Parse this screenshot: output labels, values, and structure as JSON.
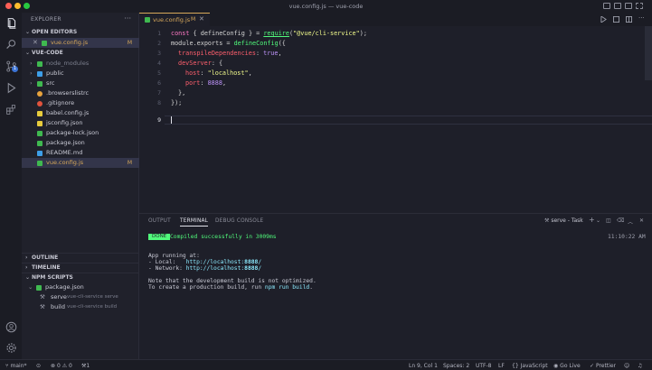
{
  "window": {
    "title": "vue.config.js — vue-code"
  },
  "colors": {
    "accent_modified": "#d7a85a",
    "badge_blue": "#3d74d6",
    "done_green": "#50fa7b"
  },
  "activity_bar": {
    "items": [
      "explorer-icon",
      "search-icon",
      "source-control-icon",
      "run-debug-icon",
      "extensions-icon"
    ],
    "source_control_badge": "1",
    "bottom": [
      "account-icon",
      "settings-gear-icon"
    ]
  },
  "sidebar": {
    "title": "EXPLORER",
    "open_editors": {
      "label": "OPEN EDITORS",
      "items": [
        {
          "name": "vue.config.js",
          "status": "M"
        }
      ]
    },
    "project": {
      "label": "VUE-CODE",
      "items": [
        {
          "name": "node_modules",
          "status": ""
        },
        {
          "name": "public",
          "status": ""
        },
        {
          "name": "src",
          "status": ""
        },
        {
          "name": ".browserslistrc",
          "status": ""
        },
        {
          "name": ".gitignore",
          "status": ""
        },
        {
          "name": "babel.config.js",
          "status": ""
        },
        {
          "name": "jsconfig.json",
          "status": ""
        },
        {
          "name": "package-lock.json",
          "status": ""
        },
        {
          "name": "package.json",
          "status": ""
        },
        {
          "name": "README.md",
          "status": ""
        },
        {
          "name": "vue.config.js",
          "status": "M"
        }
      ]
    },
    "outline": "OUTLINE",
    "timeline": "TIMELINE",
    "npm_scripts": {
      "label": "NPM SCRIPTS",
      "file": "package.json",
      "scripts": [
        {
          "name": "serve",
          "cmd": "vue-cli-service serve"
        },
        {
          "name": "build",
          "cmd": "vue-cli-service build"
        }
      ]
    }
  },
  "editor": {
    "tab": {
      "name": "vue.config.js",
      "status": "M"
    },
    "line_numbers": [
      "1",
      "2",
      "3",
      "4",
      "5",
      "6",
      "7",
      "8",
      "9"
    ],
    "code": {
      "l1": {
        "a": "const",
        "b": " { ",
        "c": "defineConfig",
        "d": " } = ",
        "e": "require",
        "f": "(",
        "g": "\"@vue/cli-service\"",
        "h": ");"
      },
      "l2": {
        "a": "module",
        "b": ".",
        "c": "exports",
        "d": " = ",
        "e": "defineConfig",
        "f": "({"
      },
      "l3": {
        "a": "transpileDependencies",
        "b": ": ",
        "c": "true",
        "d": ","
      },
      "l4": {
        "a": "devServer",
        "b": ": {"
      },
      "l5": {
        "a": "host",
        "b": ": ",
        "c": "\"localhost\"",
        "d": ","
      },
      "l6": {
        "a": "port",
        "b": ": ",
        "c": "8888",
        "d": ","
      },
      "l7": {
        "a": "},"
      },
      "l8": {
        "a": "});"
      }
    }
  },
  "panel": {
    "tabs": [
      "OUTPUT",
      "TERMINAL",
      "DEBUG CONSOLE"
    ],
    "active_tab": "TERMINAL",
    "task_label": "serve - Task",
    "terminal": {
      "done_badge": "DONE",
      "compiled": "Compiled successfully in 3009ms",
      "time": "11:10:22 AM",
      "running": "App running at:",
      "local_label": "- Local:   ",
      "local_url_pre": "http://localhost:",
      "local_port": "8888",
      "local_url_post": "/",
      "network_label": "- Network: ",
      "network_url_pre": "http://localhost:",
      "network_port": "8888",
      "network_url_post": "/",
      "note1": "Note that the development build is not optimized.",
      "note2_pre": "To create a production build, run ",
      "note2_cmd": "npm run build",
      "note2_post": "."
    }
  },
  "statusbar": {
    "branch": "main*",
    "errors": "0",
    "warnings": "0",
    "tasks": "1",
    "position": "Ln 9, Col 1",
    "spaces": "Spaces: 2",
    "encoding": "UTF-8",
    "eol": "LF",
    "language": "JavaScript",
    "golive": "Go Live",
    "prettier": "Prettier"
  }
}
